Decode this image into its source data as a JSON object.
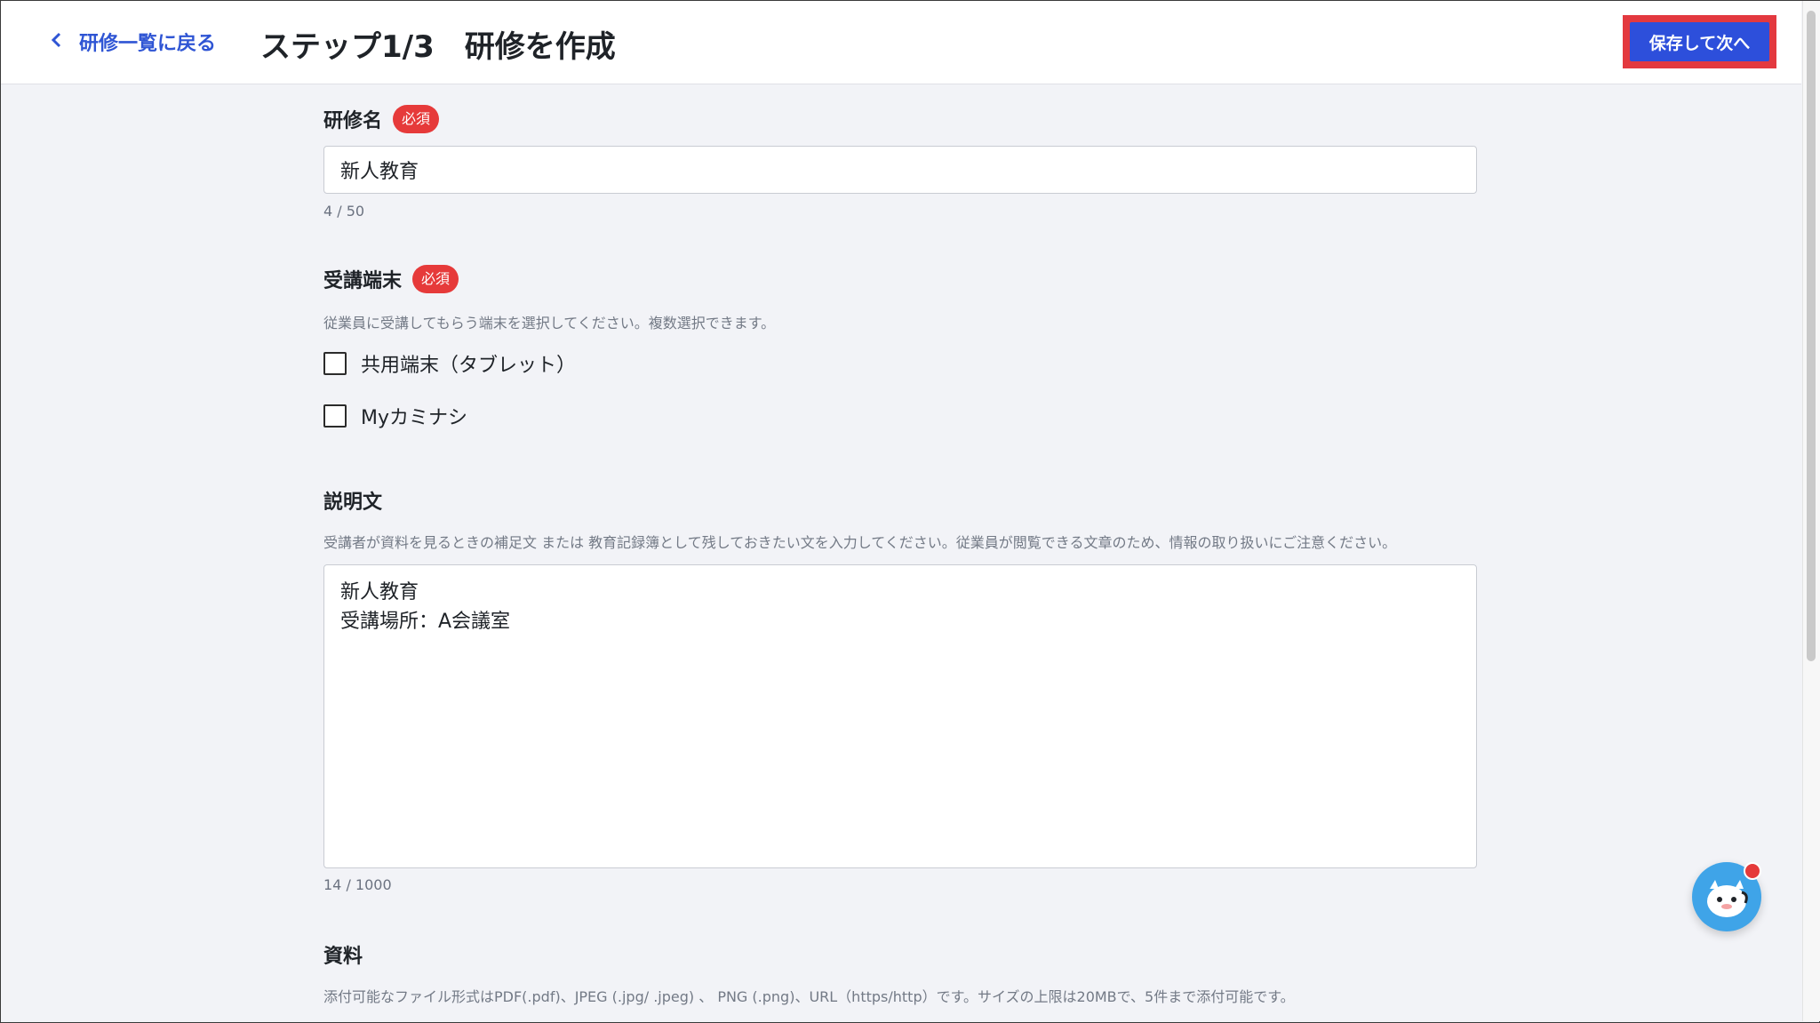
{
  "header": {
    "back_label": "研修一覧に戻る",
    "title": "ステップ1/3　研修を作成",
    "save_label": "保存して次へ"
  },
  "course_name": {
    "label": "研修名",
    "required": "必須",
    "value": "新人教育",
    "counter": "4 / 50"
  },
  "devices": {
    "label": "受講端末",
    "required": "必須",
    "hint": "従業員に受講してもらう端末を選択してください。複数選択できます。",
    "options": [
      {
        "label": "共用端末（タブレット）",
        "checked": false
      },
      {
        "label": "Myカミナシ",
        "checked": false
      }
    ]
  },
  "description": {
    "label": "説明文",
    "hint": "受講者が資料を見るときの補足文 または 教育記録簿として残しておきたい文を入力してください。従業員が閲覧できる文章のため、情報の取り扱いにご注意ください。",
    "value": "新人教育\n受講場所：A会議室",
    "counter": "14 / 1000"
  },
  "materials": {
    "label": "資料",
    "hint": "添付可能なファイル形式はPDF(.pdf)、JPEG (.jpg/ .jpeg) 、 PNG (.png)、URL（https/http）です。サイズの上限は20MBで、5件まで添付可能です。"
  },
  "colors": {
    "accent": "#2d4fdb",
    "required_badge": "#e63a3a",
    "highlight": "#e3393f",
    "background": "#f2f3f7"
  }
}
